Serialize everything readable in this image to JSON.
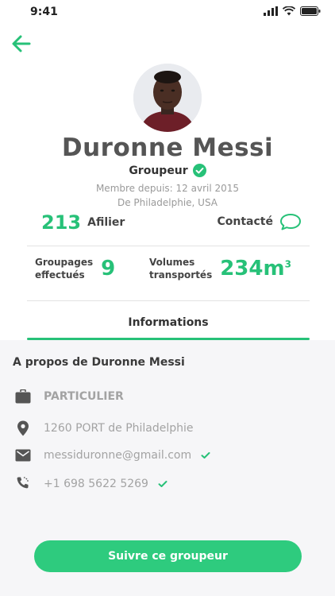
{
  "status_bar": {
    "time": "9:41"
  },
  "profile": {
    "name": "Duronne Messi",
    "role": "Groupeur",
    "member_since": "Membre depuis: 12 avril 2015",
    "location": "De Philadelphie, USA"
  },
  "stats": {
    "affiliates_count": "213",
    "affiliates_label": "Afilier",
    "contact_label": "Contacté",
    "groupings_label_line1": "Groupages",
    "groupings_label_line2": "effectués",
    "groupings_count": "9",
    "volumes_label_line1": "Volumes",
    "volumes_label_line2": "transportés",
    "volumes_value": "234m",
    "volumes_unit_exp": "3"
  },
  "tabs": [
    {
      "label": "Informations",
      "active": true
    }
  ],
  "about": {
    "title": "A propos de Duronne Messi",
    "items": [
      {
        "icon": "briefcase-icon",
        "text": "PARTICULIER",
        "verified": false
      },
      {
        "icon": "location-pin-icon",
        "text": "1260 PORT de Philadelphie",
        "verified": false
      },
      {
        "icon": "email-icon",
        "text": "messiduronne@gmail.com",
        "verified": true
      },
      {
        "icon": "phone-icon",
        "text": "+1 698 5622 5269",
        "verified": true
      }
    ]
  },
  "actions": {
    "follow_label": "Suivre ce groupeur"
  },
  "colors": {
    "accent": "#27c178",
    "button": "#2ecb7e",
    "section_bg": "#f6f6f8"
  }
}
